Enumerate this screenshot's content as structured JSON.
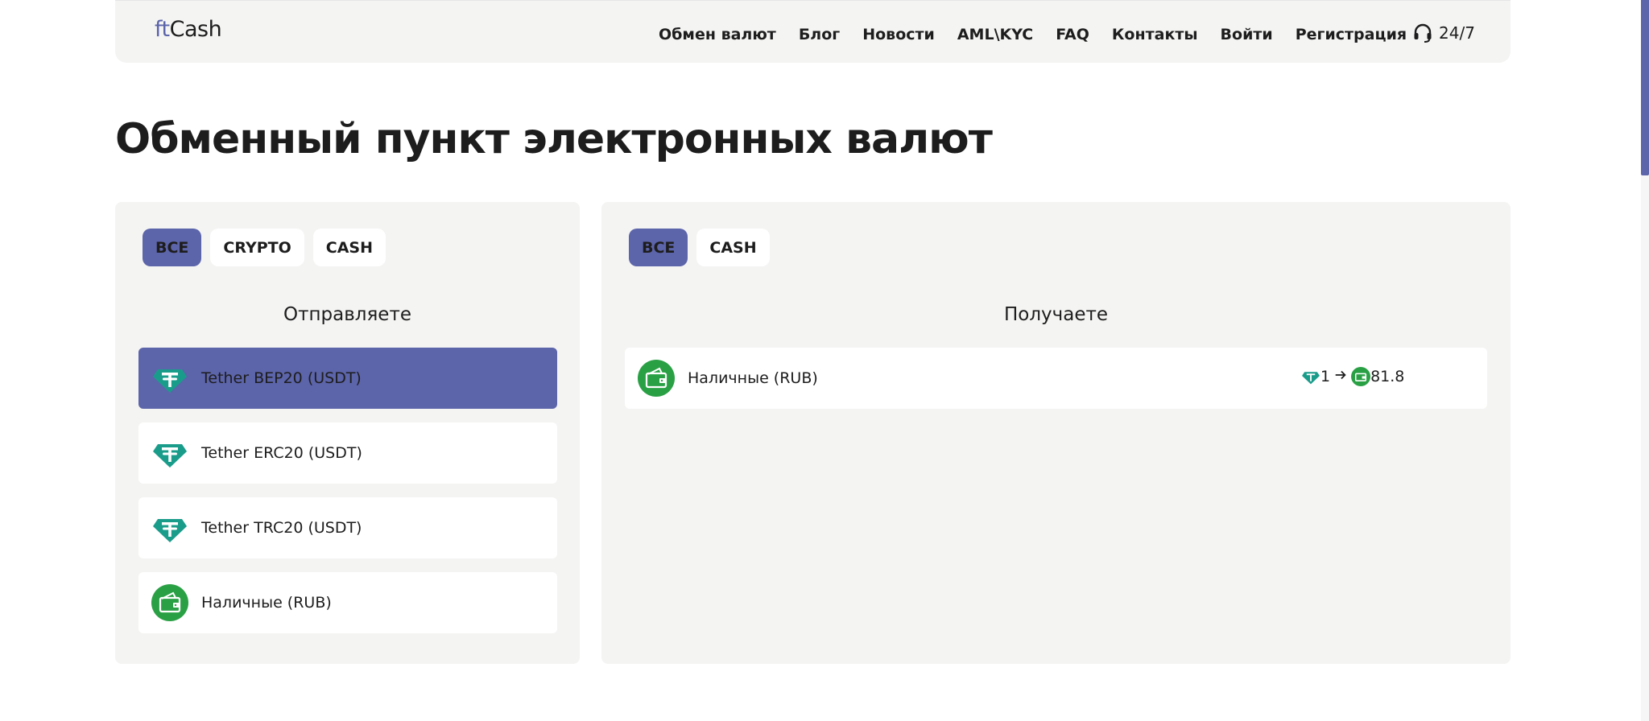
{
  "header": {
    "logo_prefix": "ft",
    "logo_suffix": "Cash",
    "nav": [
      "Обмен валют",
      "Блог",
      "Новости",
      "AML\\KYC",
      "FAQ",
      "Контакты",
      "Войти",
      "Регистрация"
    ],
    "support_label": "24/7",
    "support_icon": "headset-icon"
  },
  "page_title": "Обменный пункт электронных валют",
  "send_panel": {
    "filters": [
      {
        "label": "ВСЕ",
        "active": true
      },
      {
        "label": "CRYPTO",
        "active": false
      },
      {
        "label": "CASH",
        "active": false
      }
    ],
    "heading": "Отправляете",
    "items": [
      {
        "label": "Tether BEP20 (USDT)",
        "icon": "tether-icon",
        "selected": true
      },
      {
        "label": "Tether ERC20 (USDT)",
        "icon": "tether-icon",
        "selected": false
      },
      {
        "label": "Tether TRC20 (USDT)",
        "icon": "tether-icon",
        "selected": false
      },
      {
        "label": "Наличные (RUB)",
        "icon": "wallet-icon",
        "selected": false
      }
    ]
  },
  "receive_panel": {
    "filters": [
      {
        "label": "ВСЕ",
        "active": true
      },
      {
        "label": "CASH",
        "active": false
      }
    ],
    "heading": "Получаете",
    "items": [
      {
        "label": "Наличные (RUB)",
        "icon": "wallet-icon",
        "rate_from": "1",
        "rate_to": "81.8"
      }
    ]
  },
  "colors": {
    "accent": "#5c64aa",
    "panel_bg": "#f4f4f3",
    "tether": "#1a9c8b",
    "cash": "#2aa045"
  }
}
